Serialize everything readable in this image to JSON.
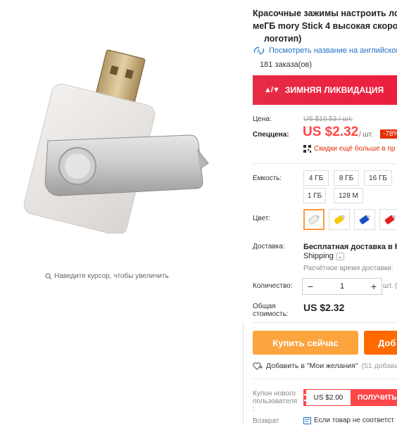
{
  "gallery": {
    "zoom_hint": "Наведите курсор, чтобы увеличить"
  },
  "product": {
    "title_line1": "Красочные зажимы настроить лог",
    "title_line2": "меГБ mory Stick 4 высокая скорост",
    "title_line3": "логотип)",
    "translate_link": "Посмотреть название на английском",
    "orders": "181 заказа(ов)"
  },
  "promo": {
    "mark": "▲/▼",
    "text": "ЗИМНЯЯ ЛИКВИДАЦИЯ"
  },
  "pricing": {
    "price_label": "Цена:",
    "old_price": "US $10.53 / шт.",
    "sale_label": "Спеццена:",
    "sale_price": "US $2.32",
    "per_unit": "/ шт.",
    "discount": "-78%",
    "more_discount": "Скидки ещё больше в пр"
  },
  "capacity": {
    "label": "Емкость:",
    "options": [
      "4 ГБ",
      "8 ГБ",
      "16 ГБ",
      "1 ГБ",
      "128 М"
    ]
  },
  "color": {
    "label": "Цвет:",
    "swatches": [
      "white",
      "yellow",
      "blue",
      "red"
    ]
  },
  "shipping": {
    "label": "Доставка:",
    "title": "Бесплатная доставка в Ru",
    "method": "Shipping",
    "eta": "Расчётное время доставки:"
  },
  "quantity": {
    "label": "Количество:",
    "minus": "−",
    "value": "1",
    "plus": "+",
    "available": "шт. (495"
  },
  "total": {
    "label_line1": "Общая",
    "label_line2": "стоимость:",
    "value": "US $2.32"
  },
  "actions": {
    "buy_now": "Купить сейчас",
    "add_to_cart": "Доб"
  },
  "wishlist": {
    "label": "Добавить в \"Мои желания\"",
    "count": "(51 добави"
  },
  "coupon": {
    "label_line1": "Купон нового",
    "label_line2": "пользователя",
    "label_line3": ":",
    "amount": "US $2.00",
    "get": "ПОЛУЧИТЬ"
  },
  "returns": {
    "label": "Возврат",
    "value": "Если товар не соответст"
  },
  "colors": {
    "accent_red": "#ff4747",
    "buy_orange": "#fca43e",
    "cart_orange": "#ff6a00",
    "link_blue": "#2270c9"
  }
}
